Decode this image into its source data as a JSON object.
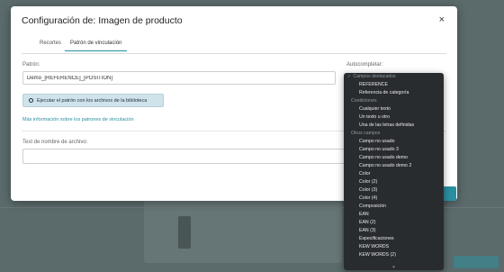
{
  "modal": {
    "title": "Configuración de: Imagen de producto",
    "close_symbol": "×",
    "tabs": [
      {
        "label": "Recortes"
      },
      {
        "label": "Patrón de vinculación"
      }
    ],
    "pattern_label": "Patrón:",
    "pattern_value": "Demo_[REFERENCE]_[POSITION]",
    "autocomplete_label": "Autocompletar:",
    "run_button": "Ejecutar el patrón con los archivos de la biblioteca",
    "more_info_link": "Más información sobre los patrones de vinculación",
    "test_label": "Test de nombre de archivo:",
    "test_value": ""
  },
  "dropdown": {
    "check": "✓",
    "items": [
      {
        "kind": "group",
        "label": "Campos destacados"
      },
      {
        "kind": "option",
        "label": "REFERENCE"
      },
      {
        "kind": "option",
        "label": "Referencia de categoría"
      },
      {
        "kind": "group",
        "label": "Condiciones"
      },
      {
        "kind": "option",
        "label": "Cualquier texto"
      },
      {
        "kind": "option",
        "label": "Un texto u otro"
      },
      {
        "kind": "option",
        "label": "Una de las letras definidas"
      },
      {
        "kind": "group",
        "label": "Otros campos"
      },
      {
        "kind": "option",
        "label": "Campo no usado"
      },
      {
        "kind": "option",
        "label": "Campo no usado 3"
      },
      {
        "kind": "option",
        "label": "Campo no usado demo"
      },
      {
        "kind": "option",
        "label": "Campo no usado demo 2"
      },
      {
        "kind": "option",
        "label": "Color"
      },
      {
        "kind": "option",
        "label": "Color (2)"
      },
      {
        "kind": "option",
        "label": "Color (3)"
      },
      {
        "kind": "option",
        "label": "Color (4)"
      },
      {
        "kind": "option",
        "label": "Composición"
      },
      {
        "kind": "option",
        "label": "EAN"
      },
      {
        "kind": "option",
        "label": "EAN (2)"
      },
      {
        "kind": "option",
        "label": "EAN (3)"
      },
      {
        "kind": "option",
        "label": "Especificaciones"
      },
      {
        "kind": "option",
        "label": "KEW WORDS"
      },
      {
        "kind": "option",
        "label": "KEW WORDS (2)"
      }
    ],
    "scroll_down_symbol": "⌄"
  },
  "colors": {
    "accent": "#2a8fa0",
    "overlay": "#3c4a4c",
    "dropdown_bg": "#292c2f"
  }
}
